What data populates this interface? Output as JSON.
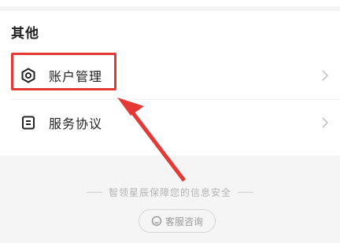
{
  "section": {
    "title": "其他"
  },
  "menu": {
    "items": [
      {
        "label": "账户管理",
        "icon": "hexagon-settings-icon"
      },
      {
        "label": "服务协议",
        "icon": "document-icon"
      }
    ]
  },
  "footer": {
    "security_text": "智领星辰保障您的信息安全",
    "service_button": "客服咨询",
    "service_icon": "customer-service-icon"
  },
  "colors": {
    "annotation": "#e53935",
    "background": "#f5f5f5"
  }
}
